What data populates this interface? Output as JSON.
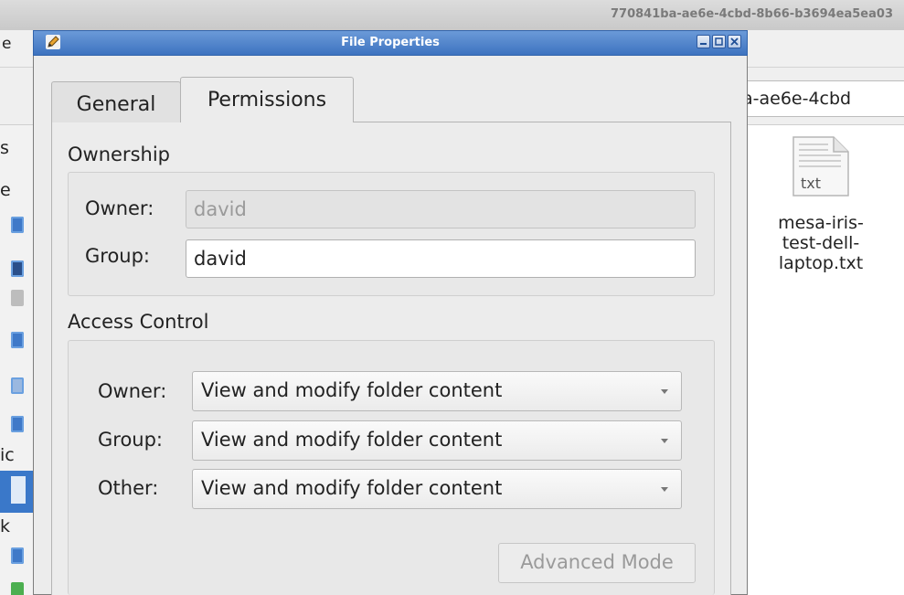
{
  "background_window": {
    "title": "770841ba-ae6e-4cbd-8b66-b3694ea5ea03",
    "menu_partial": "e",
    "path_fragment": "a-ae6e-4cbd",
    "sidebar_fragments": [
      "s",
      "e",
      "ic",
      "k"
    ],
    "file": {
      "icon": "text-file-icon",
      "icon_label": "txt",
      "name_lines": [
        "mesa-iris-",
        "test-dell-",
        "laptop.txt"
      ]
    }
  },
  "dialog": {
    "title": "File Properties",
    "icon": "pencil-icon",
    "window_buttons": [
      "minimize-icon",
      "maximize-icon",
      "close-icon"
    ],
    "tabs": [
      {
        "label": "General",
        "active": false
      },
      {
        "label": "Permissions",
        "active": true
      }
    ],
    "ownership": {
      "heading": "Ownership",
      "owner_label": "Owner:",
      "owner_value": "david",
      "group_label": "Group:",
      "group_value": "david"
    },
    "access": {
      "heading": "Access Control",
      "rows": [
        {
          "label": "Owner:",
          "value": "View and modify folder content"
        },
        {
          "label": "Group:",
          "value": "View and modify folder content"
        },
        {
          "label": "Other:",
          "value": "View and modify folder content"
        }
      ],
      "advanced_label": "Advanced Mode"
    }
  },
  "colors": {
    "title_bar": "#4f82cc",
    "sidebar_selection": "#3a78c9"
  }
}
